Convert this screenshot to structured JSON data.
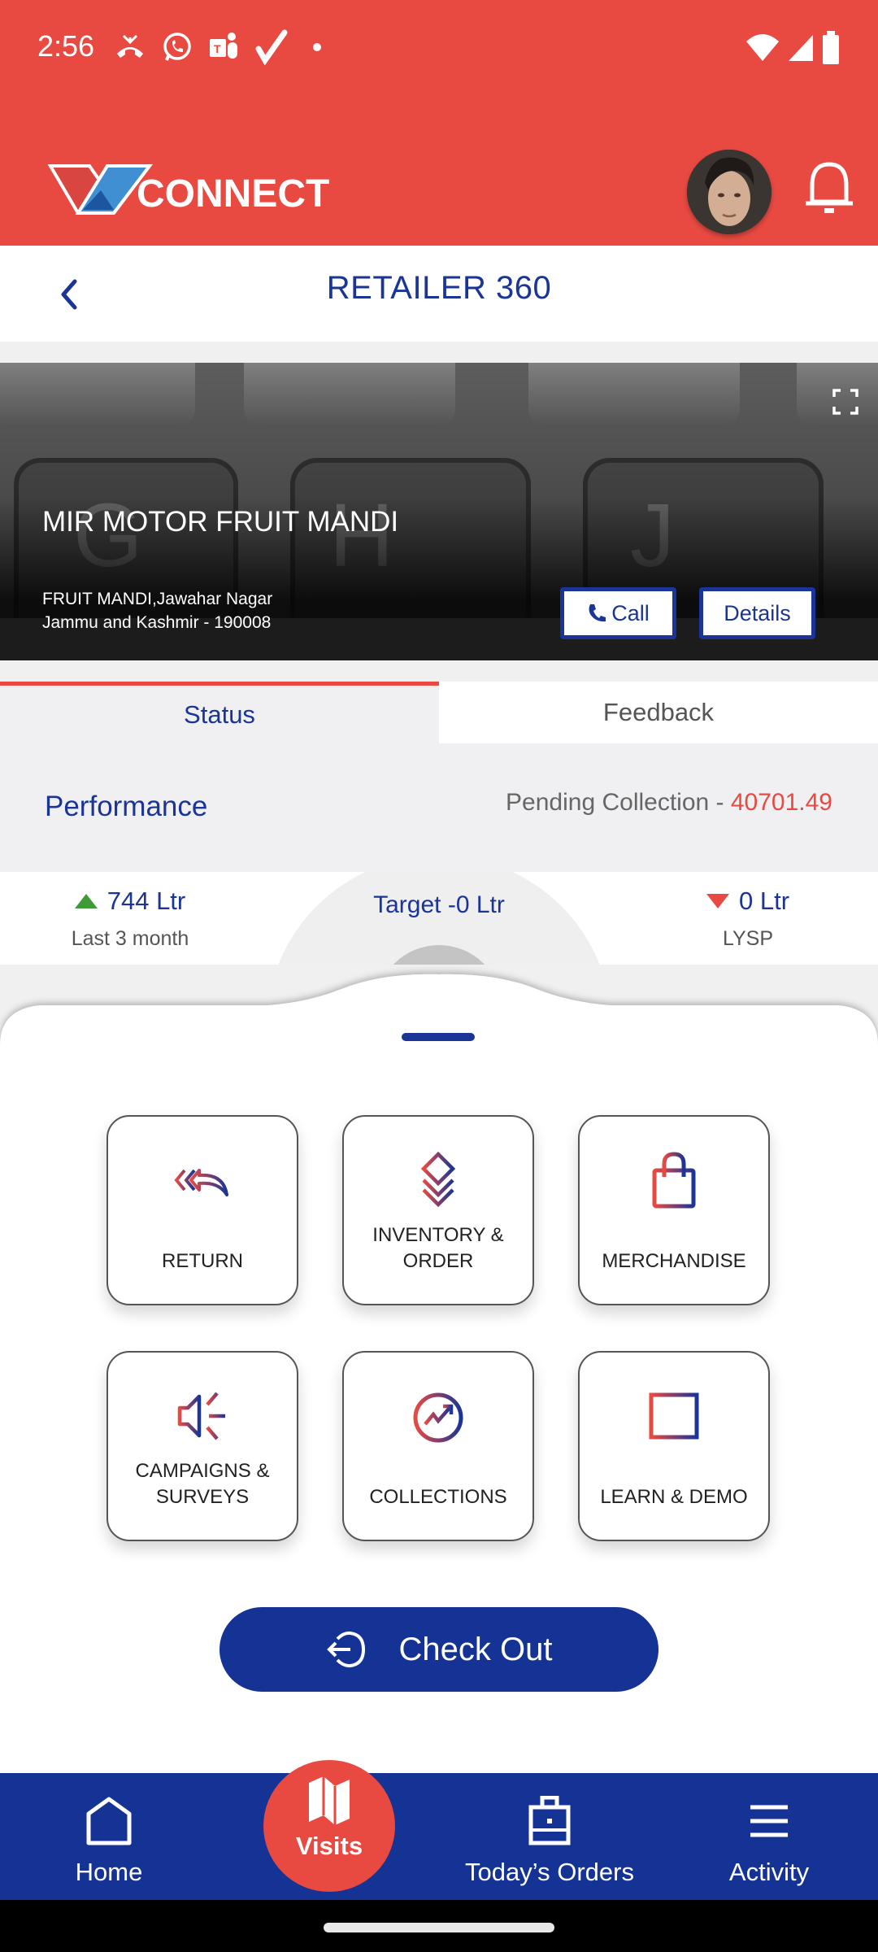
{
  "status_bar": {
    "time": "2:56",
    "left_icons": [
      "missed-call-icon",
      "whatsapp-icon",
      "teams-icon",
      "check-icon",
      "dot-icon"
    ],
    "right_icons": [
      "wifi-icon",
      "signal-icon",
      "battery-icon"
    ]
  },
  "header": {
    "logo_text": "CONNECT",
    "logo_letter": "V",
    "avatar_alt": "User avatar",
    "notification_icon": "bell-icon"
  },
  "title_bar": {
    "back_icon": "chevron-left-icon",
    "title": "RETAILER 360"
  },
  "retailer": {
    "name": "MIR MOTOR FRUIT MANDI",
    "address_line1": "FRUIT MANDI,Jawahar Nagar",
    "address_line2": "Jammu and Kashmir - 190008",
    "call_label": "Call",
    "details_label": "Details",
    "fullscreen_icon": "fullscreen-icon"
  },
  "tabs": [
    {
      "label": "Status",
      "active": true
    },
    {
      "label": "Feedback",
      "active": false
    }
  ],
  "performance": {
    "title": "Performance",
    "pending_label": "Pending Collection - ",
    "pending_value": "40701.49",
    "left_stat": {
      "value": "744 Ltr",
      "label": "Last 3 month",
      "trend": "up"
    },
    "center_stat": {
      "value": "Target -0 Ltr"
    },
    "right_stat": {
      "value": "0 Ltr",
      "label": "LYSP",
      "trend": "down"
    }
  },
  "actions": [
    {
      "label": "RETURN",
      "icon": "return-icon"
    },
    {
      "label": "INVENTORY & ORDER",
      "icon": "layers-icon"
    },
    {
      "label": "MERCHANDISE",
      "icon": "shopping-bag-icon"
    },
    {
      "label": "CAMPAIGNS & SURVEYS",
      "icon": "megaphone-icon"
    },
    {
      "label": "COLLECTIONS",
      "icon": "trending-circle-icon"
    },
    {
      "label": "LEARN & DEMO",
      "icon": "book-icon"
    }
  ],
  "checkout": {
    "label": "Check Out",
    "icon": "logout-icon"
  },
  "bottom_nav": [
    {
      "label": "Home",
      "icon": "home-icon"
    },
    {
      "label": "Visits",
      "icon": "map-icon",
      "active": true
    },
    {
      "label": "Today’s Orders",
      "icon": "briefcase-icon"
    },
    {
      "label": "Activity",
      "icon": "menu-icon"
    }
  ],
  "colors": {
    "brand_red": "#e84a42",
    "brand_blue": "#143394",
    "title_blue": "#1a3497",
    "trend_up": "#3e9b35",
    "trend_down": "#e84a42"
  }
}
